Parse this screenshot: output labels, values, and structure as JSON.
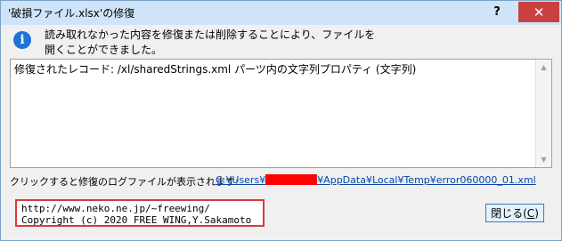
{
  "window": {
    "title": "'破損ファイル.xlsx'の修復",
    "help_label": "?",
    "close_label": "✕"
  },
  "message": {
    "icon": "info-icon",
    "icon_glyph": "i",
    "text": "読み取れなかった内容を修復または削除することにより、ファイルを開くことができました。"
  },
  "detail": {
    "text": "修復されたレコード: /xl/sharedStrings.xml パーツ内の文字列プロパティ (文字列)",
    "scroll_up": "▲",
    "scroll_down": "▼"
  },
  "log": {
    "label": "クリックすると修復のログファイルが表示されます:",
    "path_prefix": "C:¥Users¥",
    "path_suffix": "¥AppData¥Local¥Temp¥error060000_01.xml"
  },
  "credit": {
    "line1": "http://www.neko.ne.jp/~freewing/",
    "line2": "Copyright (c) 2020 FREE WING,Y.Sakamoto"
  },
  "close_button": {
    "label": "閉じる(",
    "mnemonic": "C",
    "suffix": ")"
  }
}
